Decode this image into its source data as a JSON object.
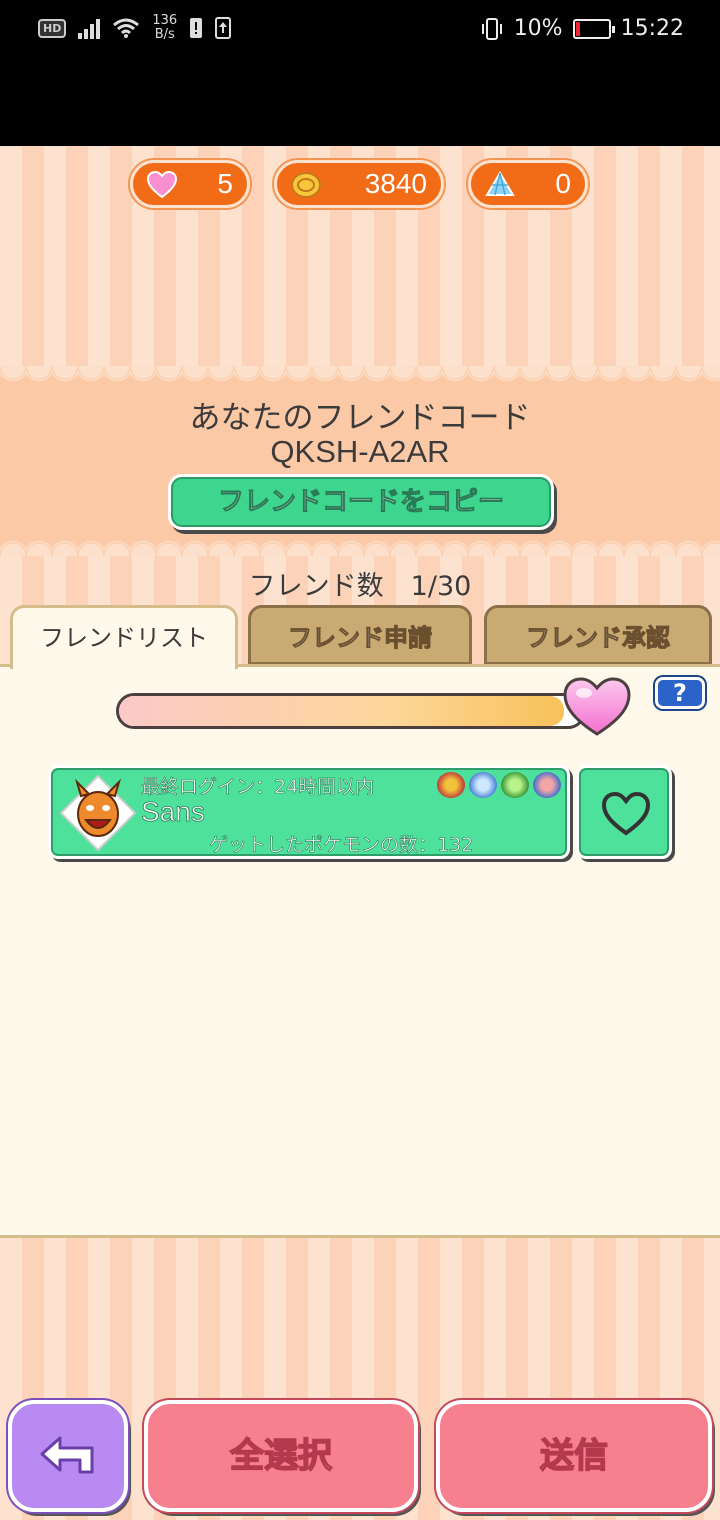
{
  "status_bar": {
    "hd": "HD",
    "speed_value": "136",
    "speed_unit": "B/s",
    "battery": "10%",
    "time": "15:22"
  },
  "currencies": {
    "hearts": "5",
    "coins": "3840",
    "diamonds": "0"
  },
  "friend_code": {
    "label": "あなたのフレンドコード",
    "code": "QKSH-A2AR",
    "copy_button": "フレンドコードをコピー"
  },
  "friend_count": "フレンド数　1/30",
  "tabs": [
    {
      "label": "フレンドリスト",
      "active": true
    },
    {
      "label": "フレンド申請",
      "active": false
    },
    {
      "label": "フレンド承認",
      "active": false
    }
  ],
  "gauge": {
    "fill_fraction": 0.96
  },
  "help_label": "?",
  "friends": [
    {
      "last_login": "最終ログイン：24時間以内",
      "name": "Sans",
      "caught": "ゲットしたポケモンの数：132"
    }
  ],
  "buttons": {
    "select_all": "全選択",
    "send": "送信"
  },
  "colors": {
    "accent_orange": "#f26b16",
    "green": "#4ee19b",
    "pink": "#f7808f",
    "purple": "#b98af2"
  }
}
